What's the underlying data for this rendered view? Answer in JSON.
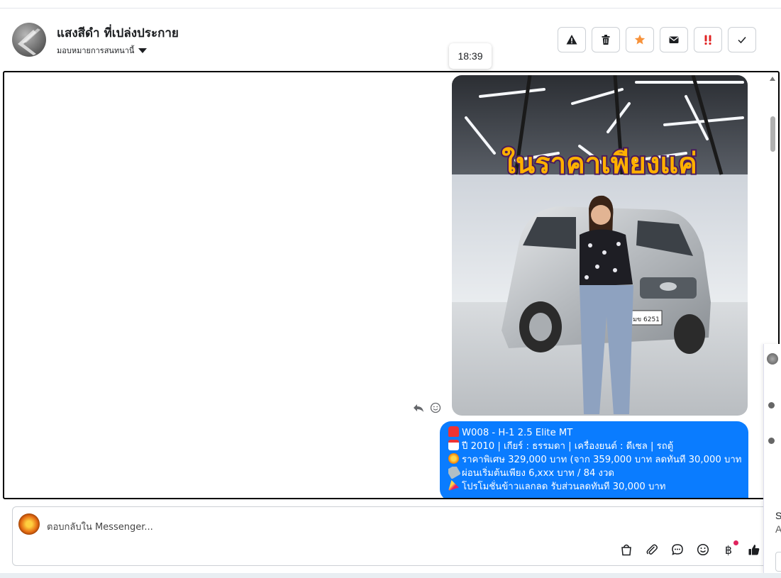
{
  "header": {
    "contact_name": "แสงสีดำ ที่เปล่งประกาย",
    "assign_label": "มอบหมายการสนทนานี้",
    "actions": [
      {
        "icon": "warning-icon",
        "color": "#1c1e21"
      },
      {
        "icon": "trash-icon",
        "color": "#1c1e21"
      },
      {
        "icon": "star-icon",
        "color": "#f7923a"
      },
      {
        "icon": "envelope-icon",
        "color": "#1c1e21"
      },
      {
        "icon": "spam-icon",
        "color": "#e02424"
      },
      {
        "icon": "check-icon",
        "color": "#1c1e21"
      }
    ]
  },
  "tooltip": {
    "time": "18:39"
  },
  "media": {
    "overlay_text": "ในราคาเพียงแค่",
    "plate_text": "มข 6251"
  },
  "message": {
    "lines": [
      "W008 - H-1 2.5 Elite MT",
      "ปี 2010 | เกียร์ : ธรรมดา | เครื่องยนต์ : ดีเซล | รถตู้",
      "ราคาพิเศษ 329,000 บาท (จาก 359,000 บาท ลดทันที 30,000 บาท!)",
      "ผ่อนเริ่มต้นเพียง 6,xxx บาท / 84 งวด",
      "โปรโมชั่นข้าวแลกลด รับส่วนลดทันที 30,000 บาท"
    ],
    "line_icons": [
      "car-emoji",
      "calendar-emoji",
      "boom-emoji",
      "money-emoji",
      "party-emoji"
    ],
    "inline_icons": [
      "gear-emoji",
      "fuel-emoji",
      "car-emoji"
    ],
    "bubble_color": "#0a7cff"
  },
  "composer": {
    "placeholder": "ตอบกลับใน Messenger...",
    "currency_symbol": "฿",
    "tools": [
      "shopping-bag-icon",
      "paperclip-icon",
      "chat-bubble-icon",
      "emoji-icon",
      "baht-icon",
      "thumbs-up-icon"
    ]
  },
  "side_panel": {
    "line1": "S",
    "line2": "A"
  }
}
